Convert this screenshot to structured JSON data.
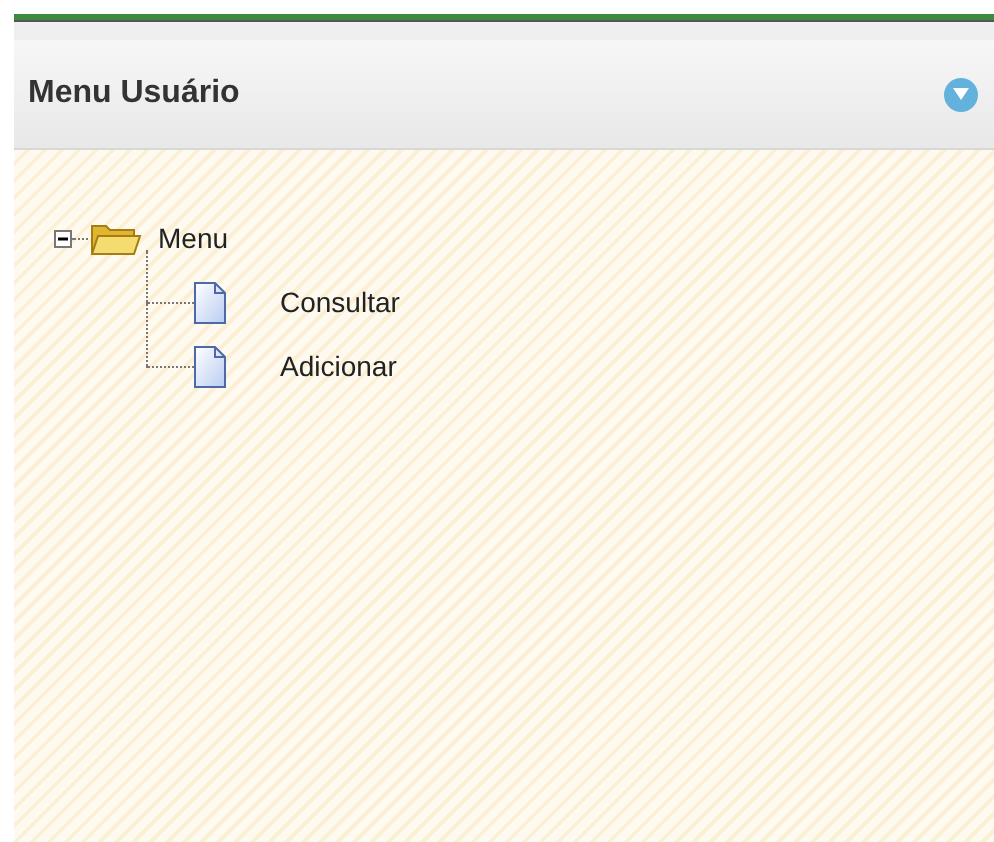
{
  "panel": {
    "title": "Menu Usuário",
    "collapsed": false
  },
  "tree": [
    {
      "label": "Menu",
      "kind": "folder",
      "expanded": true,
      "children": [
        {
          "label": "Consultar",
          "kind": "page"
        },
        {
          "label": "Adicionar",
          "kind": "page"
        }
      ]
    }
  ]
}
